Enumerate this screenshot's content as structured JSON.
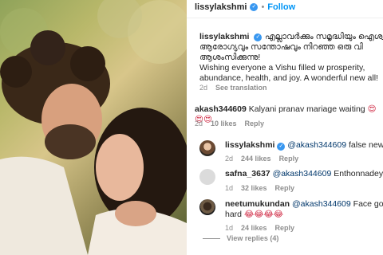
{
  "post": {
    "username": "lissylakshmi",
    "separator": "•",
    "follow_label": "Follow"
  },
  "caption": {
    "username": "lissylakshmi",
    "malayalam": "എല്ലാവർക്കും സമൃദ്ധിയും ഐശ്വ ആരോഗ്യവും സന്തോഷവും നിറഞ്ഞ ഒരു വി ആശംസിക്കുന്നു!",
    "english": "Wishing everyone a Vishu filled w prosperity, abundance, health, and joy. A wonderful new all!",
    "time": "2d",
    "see_translation": "See translation"
  },
  "comments": [
    {
      "username": "akash344609",
      "text": "Kalyani pranav mariage waiting",
      "emoji": "😍😍😍",
      "time": "2d",
      "likes": "10 likes",
      "reply": "Reply"
    },
    {
      "username": "lissylakshmi",
      "mention": "@akash344609",
      "text": "false news !",
      "time": "2d",
      "likes": "244 likes",
      "reply": "Reply"
    },
    {
      "username": "safna_3637",
      "mention": "@akash344609",
      "text": "Enthonnadey",
      "emoji": "😂",
      "time": "1d",
      "likes": "32 likes",
      "reply": "Reply"
    },
    {
      "username": "neetumukundan",
      "mention": "@akash344609",
      "text": "Face got slap",
      "text2": "hard",
      "emoji": "😂😂😂😂",
      "time": "1d",
      "likes": "24 likes",
      "reply": "Reply"
    }
  ],
  "view_replies": "View replies (4)",
  "colors": {
    "link": "#0095f6",
    "mention": "#00376b",
    "muted": "#8e8e8e",
    "verified": "#3897f0"
  }
}
